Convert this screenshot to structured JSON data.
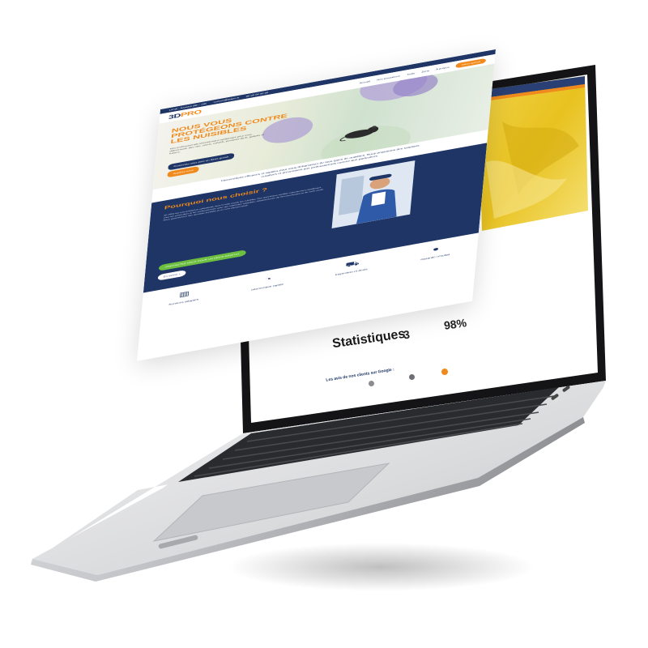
{
  "brand": {
    "logo_prefix": "3D",
    "logo_suffix": "PRO"
  },
  "topbar": {
    "items": [
      "Lundi - Samedi 08h - 20h",
      "contact@3dpro.fr",
      "06 00 00 00 00"
    ]
  },
  "nav": {
    "items": [
      "Accueil",
      "Nos prestations",
      "Tarifs",
      "Zone",
      "À propos"
    ],
    "cta": "Devis gratuit"
  },
  "hero": {
    "title": "NOUS VOUS PROTÉGEONS CONTRE LES NUISIBLES",
    "description": "Nos professionnels interviennent rapidement pour vous débarrasser des rats, souris, cafards, punaises de lit, guêpes et frelons.",
    "button_primary": "Contactez-nous pour un devis gratuit",
    "button_secondary": "Appelez-nous"
  },
  "intro": {
    "text": "Interventions efficaces et rapides pour vous débarrasser de tous types de nuisibles. Nous proposons des solutions curatives et préventives aux professionnels comme aux particuliers."
  },
  "why": {
    "title": "Pourquoi nous choisir ?",
    "body": "3D PRO est une entreprise spécialisée dans la lutte contre les nuisibles. Nos techniciens certifiés interviennent rapidement chez les particuliers et les professionnels avec des méthodes adaptées, respectueuses de l'environnement et de votre santé. Nous garantissons des résultats durables et un suivi personnalisé.",
    "button_primary": "CONTACTEZ-NOUS POUR UN DEVIS GRATUIT",
    "button_secondary": "En savoir +"
  },
  "features": [
    {
      "icon": "chart-icon",
      "label": "Services adaptés"
    },
    {
      "icon": "gauge-icon",
      "label": "Intervention rapide"
    },
    {
      "icon": "truck-icon",
      "label": "Inspection et devis"
    },
    {
      "icon": "user-icon",
      "label": "Garantie résultat"
    }
  ],
  "stats": {
    "title": "Statistiques",
    "value_1": "3",
    "value_2": "98%",
    "reviews_label": "Les avis de nos clients sur Google :"
  },
  "colors": {
    "navy": "#1e3566",
    "orange": "#f08a1c",
    "green": "#6cbf3f"
  }
}
